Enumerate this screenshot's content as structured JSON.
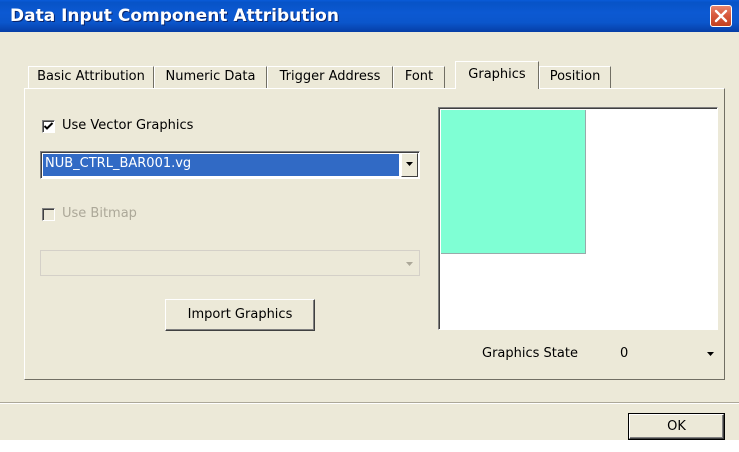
{
  "window": {
    "title": "Data Input Component Attribution"
  },
  "tabs": [
    {
      "label": "Basic Attribution",
      "active": false
    },
    {
      "label": "Numeric Data",
      "active": false
    },
    {
      "label": "Trigger Address",
      "active": false
    },
    {
      "label": "Font",
      "active": false
    },
    {
      "label": "Graphics",
      "active": true
    },
    {
      "label": "Position",
      "active": false
    }
  ],
  "graphics": {
    "use_vector_label": "Use Vector Graphics",
    "use_vector_checked": true,
    "vector_file": "NUB_CTRL_BAR001.vg",
    "use_bitmap_label": "Use Bitmap",
    "use_bitmap_checked": false,
    "bitmap_file": "",
    "import_button": "Import Graphics",
    "preview_fill_color": "#7fffd4"
  },
  "state": {
    "label": "Graphics State",
    "value": "0"
  },
  "footer": {
    "ok_label": "OK"
  },
  "colors": {
    "titlebar": "#0b56cc",
    "dialog_bg": "#ece9d8",
    "selection": "#316ac5",
    "close_button": "#d85a3e"
  }
}
